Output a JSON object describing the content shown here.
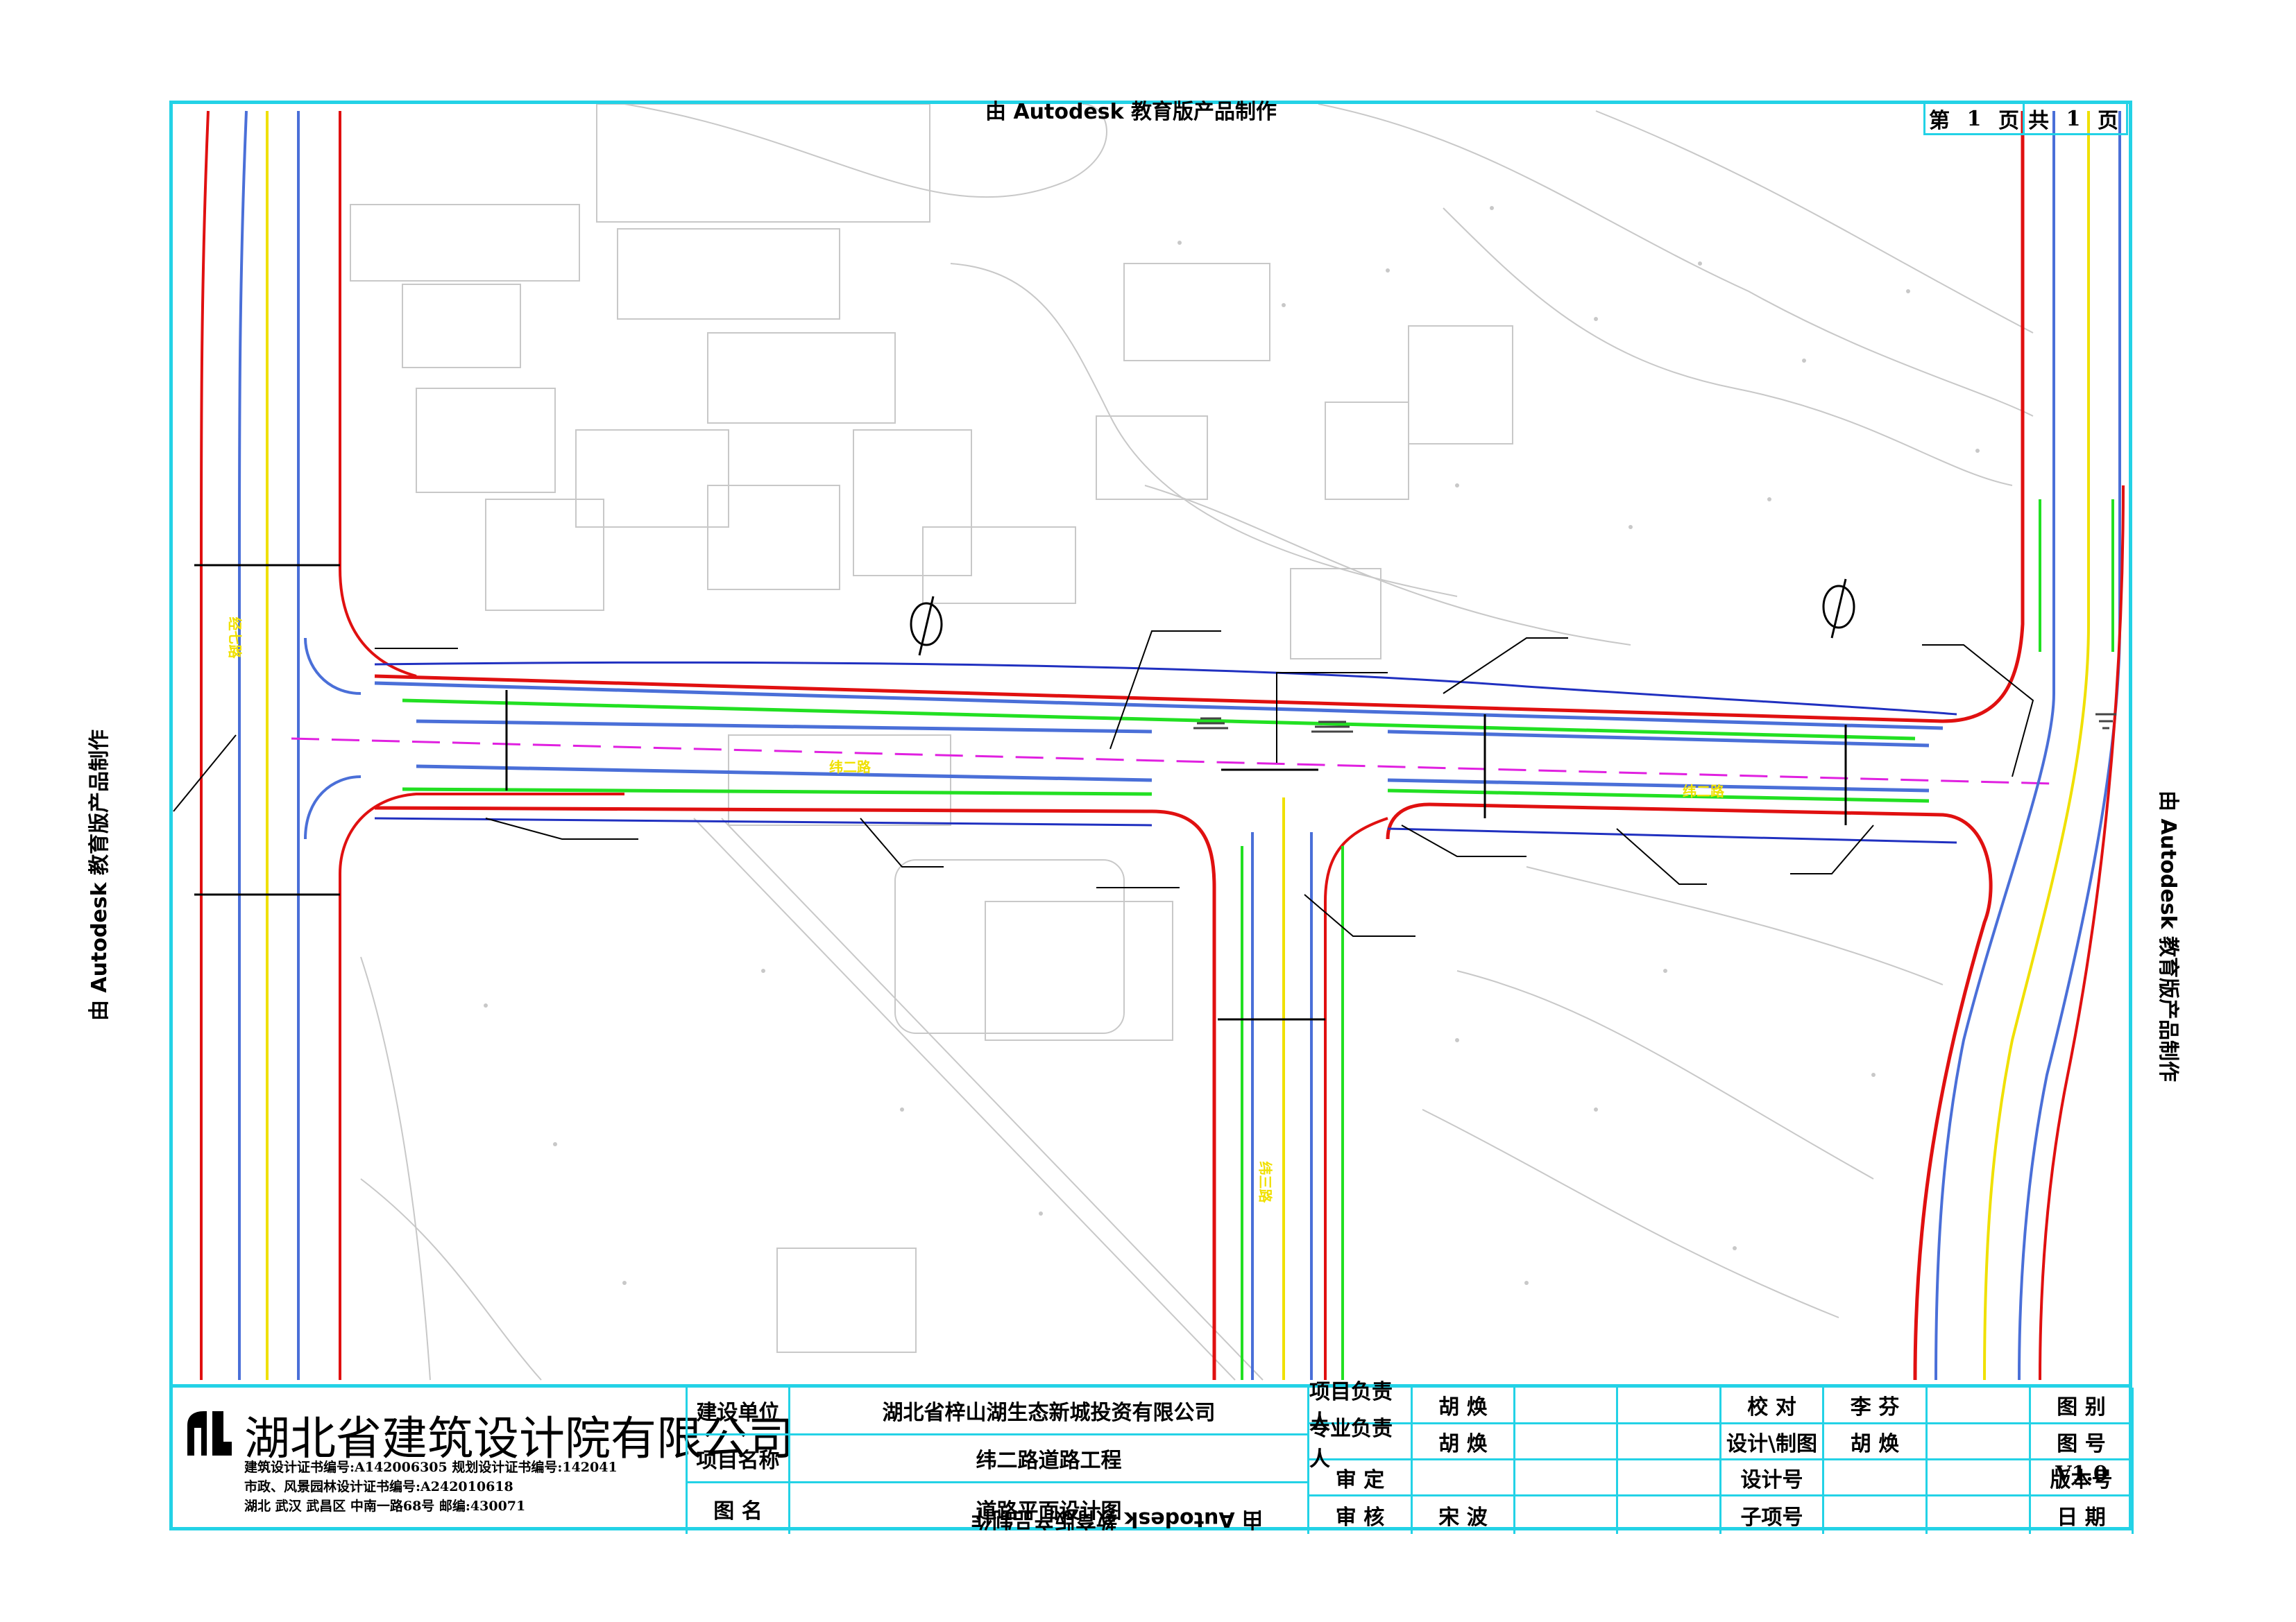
{
  "watermark": "由 Autodesk 教育版产品制作",
  "page_box": {
    "label_page": "第",
    "page_no": "1",
    "label_page_unit": "页",
    "label_total": "共",
    "total_no": "1",
    "label_total_unit": "页"
  },
  "road_labels": {
    "main_west": "纬二路",
    "main_east": "纬二路",
    "south_branch": "纬三路",
    "west_road": "经七路"
  },
  "colors": {
    "frame": "#23d2e6",
    "red_line": "#e01010",
    "blue_line": "#4a6fd8",
    "green_line": "#22e022",
    "yellow_line": "#f0e000",
    "magenta_line": "#e020e0",
    "terrain": "#cccccc"
  },
  "title_block": {
    "company": {
      "name": "湖北省建筑设计院有限公司",
      "cert_line1": "建筑设计证书编号:A142006305   规划设计证书编号:142041",
      "cert_line2": "市政、风景园林设计证书编号:A242010618",
      "address": "湖北 武汉 武昌区 中南一路68号 邮编:430071",
      "logo_icon": "company-logo-icon"
    },
    "rows": [
      {
        "label": "建设单位",
        "value": "湖北省梓山湖生态新城投资有限公司"
      },
      {
        "label": "项目名称",
        "value": "纬二路道路工程"
      },
      {
        "label": "图   名",
        "value": "道路平面设计图"
      }
    ],
    "personnel": [
      {
        "role": "项目负责人",
        "name": "胡   焕"
      },
      {
        "role": "专业负责人",
        "name": "胡   焕"
      },
      {
        "role": "审   定",
        "name": ""
      },
      {
        "role": "审   核",
        "name": "宋   波"
      }
    ],
    "checks": [
      {
        "role": "校   对",
        "name": "李   芬"
      },
      {
        "role": "设计\\制图",
        "name": "胡   焕"
      },
      {
        "role": "设计号",
        "name": ""
      },
      {
        "role": "子项号",
        "name": ""
      }
    ],
    "drawing_info": [
      {
        "label": "图   别",
        "value": ""
      },
      {
        "label": "图   号",
        "value": ""
      },
      {
        "label": "版本号",
        "value": "V1.0"
      },
      {
        "label": "日   期",
        "value": ""
      }
    ]
  }
}
